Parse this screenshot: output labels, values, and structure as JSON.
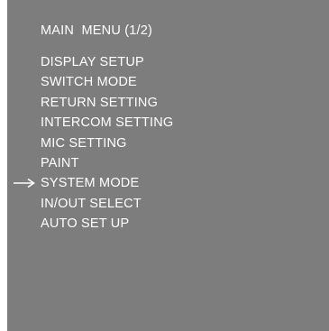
{
  "menu": {
    "title": "MAIN  MENU (1/2)",
    "selected_index": 6,
    "items": [
      {
        "label": "DISPLAY SETUP"
      },
      {
        "label": "SWITCH MODE"
      },
      {
        "label": "RETURN SETTING"
      },
      {
        "label": "INTERCOM SETTING"
      },
      {
        "label": "MIC SETTING"
      },
      {
        "label": "PAINT"
      },
      {
        "label": "SYSTEM MODE"
      },
      {
        "label": "IN/OUT SELECT"
      },
      {
        "label": "AUTO SET UP"
      }
    ]
  },
  "colors": {
    "screen_background": "#7d7d7d",
    "text": "#ffffff",
    "cursor": "#ffffff"
  },
  "icons": {
    "cursor": "right-arrow-icon"
  }
}
